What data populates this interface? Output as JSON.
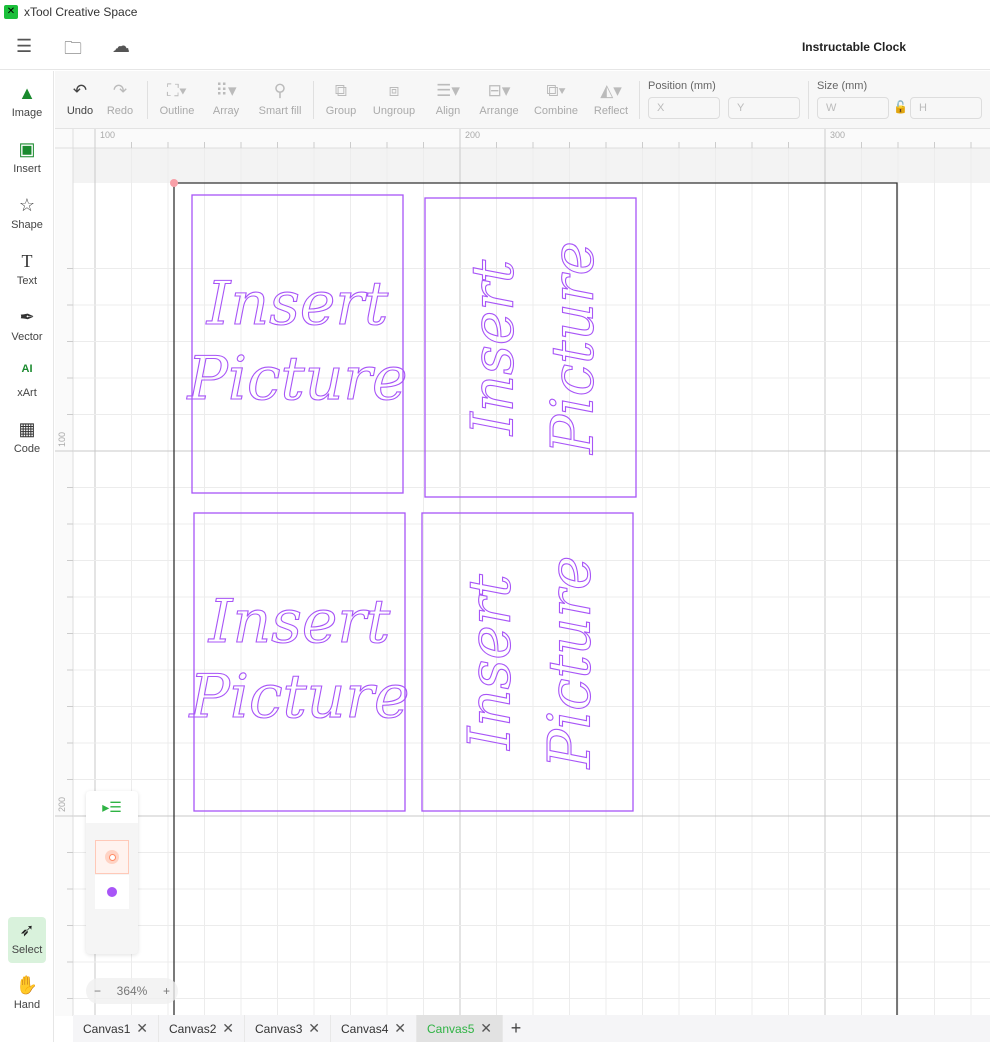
{
  "app": {
    "title": "xTool Creative Space",
    "project_title": "Instructable Clock"
  },
  "topbar": {
    "icons": [
      "menu-settings-icon",
      "folder-icon",
      "cloud-icon"
    ]
  },
  "sidebar": {
    "items": [
      {
        "label": "Image",
        "icon": "image-icon"
      },
      {
        "label": "Insert",
        "icon": "insert-icon"
      },
      {
        "label": "Shape",
        "icon": "star-icon"
      },
      {
        "label": "Text",
        "icon": "text-icon"
      },
      {
        "label": "Vector",
        "icon": "pen-icon"
      },
      {
        "label": "xArt",
        "icon": "ai-icon"
      },
      {
        "label": "Code",
        "icon": "qr-code-icon"
      }
    ],
    "bottom": [
      {
        "label": "Select",
        "icon": "cursor-icon",
        "active": true
      },
      {
        "label": "Hand",
        "icon": "hand-icon"
      }
    ]
  },
  "toolbar": {
    "buttons": [
      {
        "label": "Undo",
        "enabled": true
      },
      {
        "label": "Redo"
      },
      {
        "label": "Outline"
      },
      {
        "label": "Array"
      },
      {
        "label": "Smart fill"
      },
      {
        "label": "Group"
      },
      {
        "label": "Ungroup"
      },
      {
        "label": "Align"
      },
      {
        "label": "Arrange"
      },
      {
        "label": "Combine"
      },
      {
        "label": "Reflect"
      }
    ],
    "position_label": "Position (mm)",
    "x_placeholder": "X",
    "y_placeholder": "Y",
    "size_label": "Size (mm)",
    "w_placeholder": "W",
    "h_placeholder": "H"
  },
  "ruler": {
    "x_labels": [
      "100",
      "200",
      "300"
    ],
    "y_labels": [
      "100",
      "200"
    ]
  },
  "canvas": {
    "objects": [
      {
        "text": [
          "Insert",
          "Picture"
        ],
        "rotated": false
      },
      {
        "text": [
          "Insert",
          "Picture"
        ],
        "rotated": true
      },
      {
        "text": [
          "Insert",
          "Picture"
        ],
        "rotated": false
      },
      {
        "text": [
          "Insert",
          "Picture"
        ],
        "rotated": true
      }
    ],
    "object_color": "#a855f7"
  },
  "layers": {
    "colors": [
      "#ff8a65",
      "#a855f7"
    ]
  },
  "zoom": {
    "value": "364%",
    "minus": "−",
    "plus": "+"
  },
  "tabs": {
    "items": [
      "Canvas1",
      "Canvas2",
      "Canvas3",
      "Canvas4",
      "Canvas5"
    ],
    "active": "Canvas5",
    "add": "+",
    "close": "✕"
  }
}
